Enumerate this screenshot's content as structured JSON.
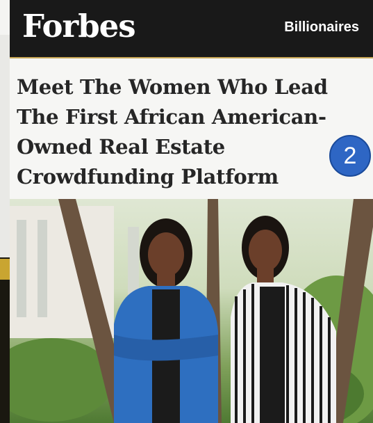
{
  "header": {
    "logo": "Forbes",
    "section": "Billionaires"
  },
  "article": {
    "headline": "Meet The Women Who Lead The First African American-Owned Real Estate Crowdfunding Platform"
  },
  "overlay": {
    "badge_number": "2",
    "badge_color": "#2e66c4"
  },
  "colors": {
    "header_bg": "#191919",
    "accent_rule": "#c7a656"
  }
}
